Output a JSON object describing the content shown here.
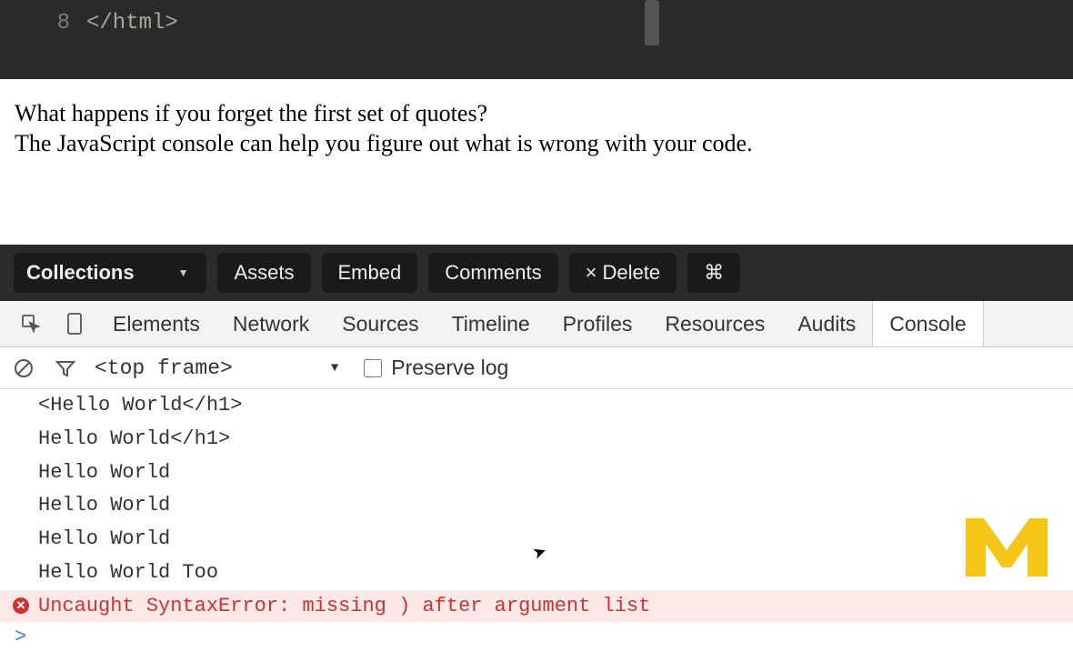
{
  "editor": {
    "line_number": "8",
    "code_text": "</html>"
  },
  "page": {
    "line1": "What happens if you forget the first set of quotes?",
    "line2": "The JavaScript console can help you figure out what is wrong with your code."
  },
  "toolbar": {
    "collections_label": "Collections",
    "assets_label": "Assets",
    "embed_label": "Embed",
    "comments_label": "Comments",
    "delete_label": "× Delete",
    "cmd_label": "⌘"
  },
  "devtools": {
    "tabs": {
      "elements": "Elements",
      "network": "Network",
      "sources": "Sources",
      "timeline": "Timeline",
      "profiles": "Profiles",
      "resources": "Resources",
      "audits": "Audits",
      "console": "Console"
    }
  },
  "console_toolbar": {
    "frame_label": "<top frame>",
    "preserve_log_label": "Preserve log"
  },
  "console": {
    "lines": [
      "<Hello World</h1>",
      "Hello World</h1>",
      "Hello World",
      "Hello World",
      "Hello World",
      "Hello World Too"
    ],
    "error": "Uncaught SyntaxError: missing ) after argument list",
    "prompt": ">"
  }
}
